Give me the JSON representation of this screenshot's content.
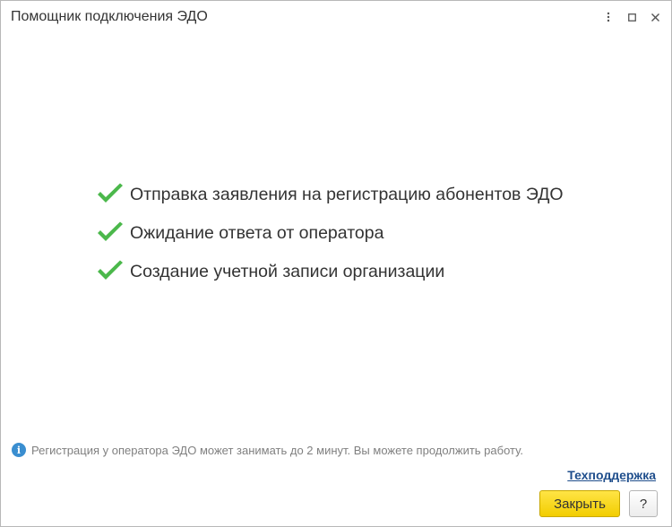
{
  "window": {
    "title": "Помощник подключения ЭДО"
  },
  "steps": [
    {
      "label": "Отправка заявления на регистрацию абонентов ЭДО",
      "status": "done"
    },
    {
      "label": "Ожидание ответа от оператора",
      "status": "done"
    },
    {
      "label": "Создание учетной записи организации",
      "status": "done"
    }
  ],
  "info": {
    "icon_text": "i",
    "text": "Регистрация у оператора ЭДО может занимать до 2 минут. Вы можете продолжить работу."
  },
  "support_link": "Техподдержка",
  "buttons": {
    "close_label": "Закрыть",
    "help_label": "?"
  },
  "icons": {
    "check": "check-icon",
    "info": "info-icon",
    "more": "more-vertical-icon",
    "maximize": "maximize-icon",
    "close": "close-icon"
  },
  "colors": {
    "check": "#4bb84b",
    "primary_button": "#f5d30a",
    "link": "#1f4e8c",
    "info": "#3a8ed0"
  }
}
